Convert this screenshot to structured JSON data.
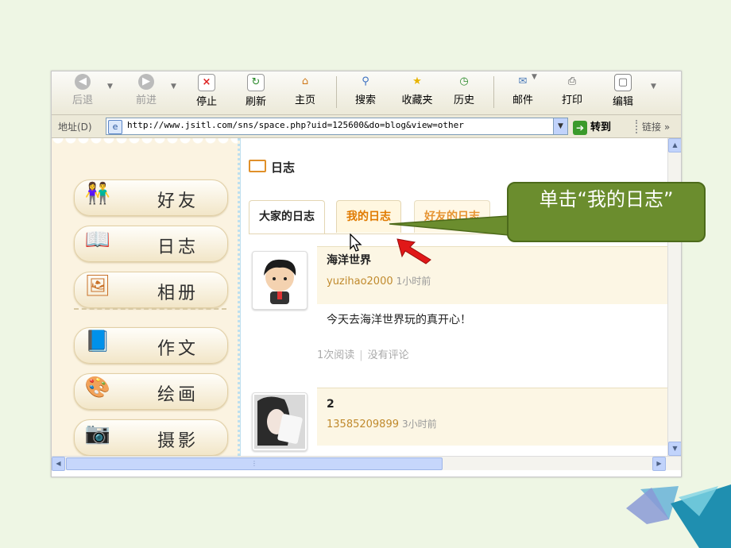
{
  "toolbar": {
    "back": "后退",
    "forward": "前进",
    "stop": "停止",
    "refresh": "刷新",
    "home": "主页",
    "search": "搜索",
    "favorites": "收藏夹",
    "history": "历史",
    "mail": "邮件",
    "print": "打印",
    "edit": "编辑"
  },
  "address_bar": {
    "label": "地址(D)",
    "url": "http://www.jsitl.com/sns/space.php?uid=125600&do=blog&view=other",
    "go_label": "转到",
    "links_label": "链接"
  },
  "sidebar": {
    "items": [
      {
        "label": "好友",
        "icon": "friends-icon"
      },
      {
        "label": "日志",
        "icon": "diary-icon"
      },
      {
        "label": "相册",
        "icon": "album-icon"
      },
      {
        "label": "作文",
        "icon": "composition-icon"
      },
      {
        "label": "绘画",
        "icon": "painting-icon"
      },
      {
        "label": "摄影",
        "icon": "camera-icon"
      }
    ]
  },
  "main": {
    "heading": "日志",
    "tabs": [
      {
        "label": "大家的日志"
      },
      {
        "label": "我的日志"
      },
      {
        "label": "好友的日志"
      }
    ],
    "posts": [
      {
        "title": "海洋世界",
        "author": "yuzihao2000",
        "time": "1小时前",
        "body": "今天去海洋世界玩的真开心！",
        "reads": "1次阅读",
        "comments": "没有评论"
      },
      {
        "title": "2",
        "author": "13585209899",
        "time": "3小时前"
      }
    ]
  },
  "callout": {
    "text": "单击“我的日志”"
  },
  "colors": {
    "callout_bg": "#6b8d2e",
    "tab_active_text": "#e07a00",
    "arrow_red": "#e01818"
  }
}
